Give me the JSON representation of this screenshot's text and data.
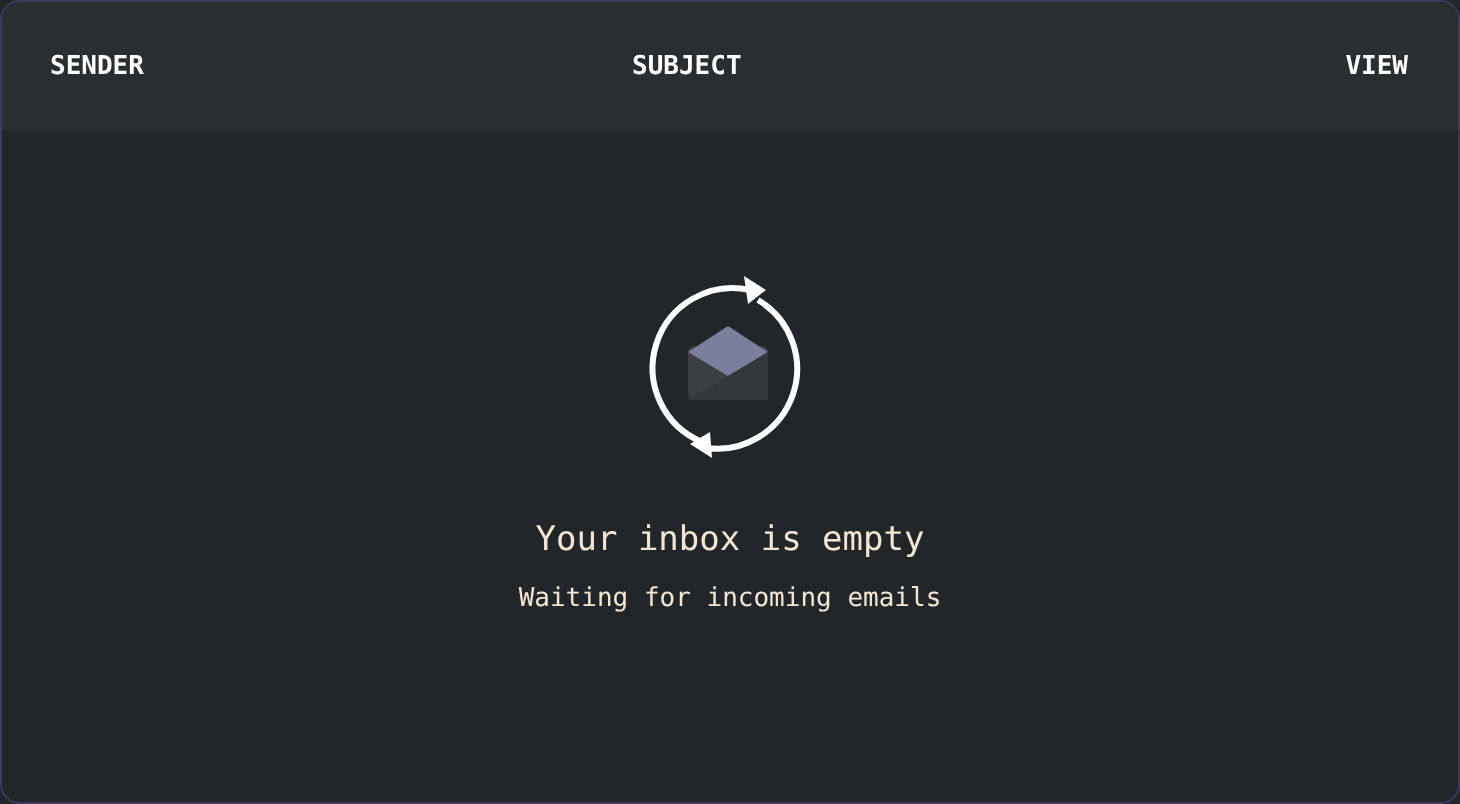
{
  "table": {
    "columns": [
      {
        "label": "SENDER"
      },
      {
        "label": "SUBJECT"
      },
      {
        "label": "VIEW"
      }
    ]
  },
  "empty_state": {
    "title": "Your inbox is empty",
    "subtitle": "Waiting for incoming emails"
  }
}
